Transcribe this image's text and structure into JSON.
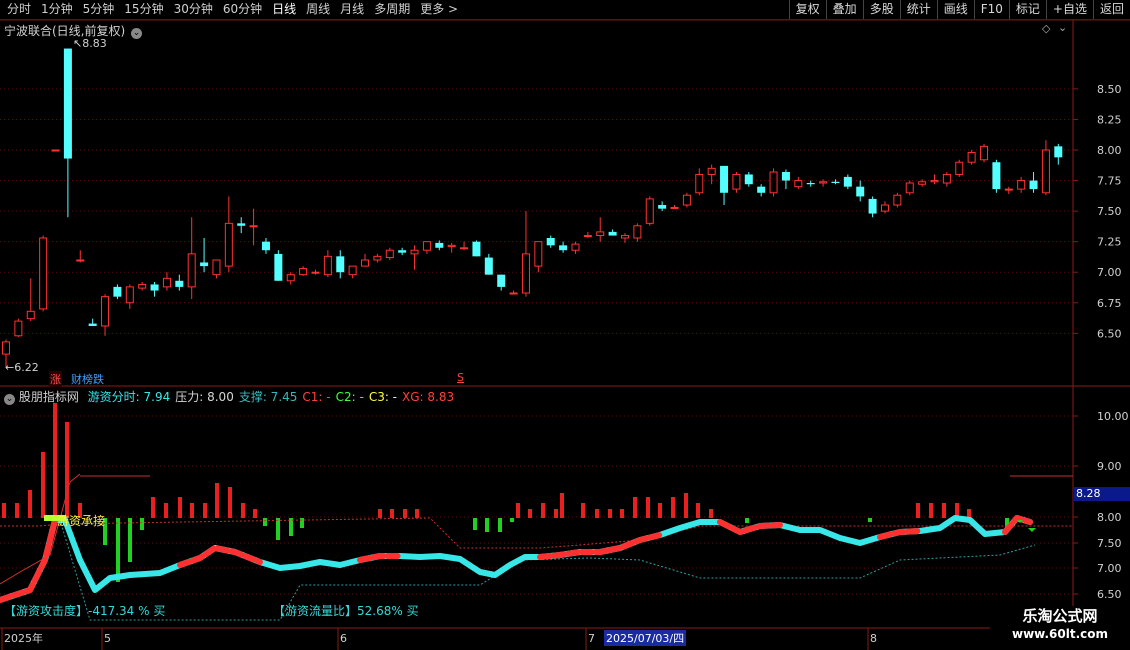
{
  "toolbar": {
    "periods": [
      "分时",
      "1分钟",
      "5分钟",
      "15分钟",
      "30分钟",
      "60分钟",
      "日线",
      "周线",
      "月线",
      "多周期",
      "更多 >"
    ],
    "active_period": "日线",
    "actions": [
      "复权",
      "叠加",
      "多股",
      "统计",
      "画线",
      "F10",
      "标记",
      "+自选",
      "返回"
    ]
  },
  "main_panel": {
    "title": "宁波联合(日线,前复权)",
    "high_marker": "8.83",
    "low_marker": "6.22",
    "y_ticks": [
      "8.50",
      "8.25",
      "8.00",
      "7.75",
      "7.50",
      "7.25",
      "7.00",
      "6.75",
      "6.50"
    ],
    "events": {
      "zhang": "涨",
      "caibang": "财榜跌",
      "s": "S"
    }
  },
  "indicator_panel": {
    "name": "股朋指标网",
    "values": [
      {
        "label": "游资分时: 7.94",
        "color": "#38e8e8"
      },
      {
        "label": "压力: 8.00",
        "color": "#d8d8d8"
      },
      {
        "label": "支撑: 7.45",
        "color": "#38b8b8"
      },
      {
        "label": "C1: -",
        "color": "#ff4040"
      },
      {
        "label": "C2: -",
        "color": "#40ff40"
      },
      {
        "label": "C3: -",
        "color": "#ffff40"
      },
      {
        "label": "XG: 8.83",
        "color": "#ff4040"
      }
    ],
    "y_ticks": [
      "10.00",
      "9.00",
      "8.00",
      "7.50",
      "7.00",
      "6.50"
    ],
    "current_value": "8.28",
    "annotation": "游资承接",
    "footer_left": "【游资攻击度】-417.34 % 买",
    "footer_right": "【游资流量比】52.68% 买"
  },
  "date_axis": {
    "labels": [
      "2025年",
      "5",
      "6",
      "7",
      "8"
    ],
    "cursor_date": "2025/07/03/四"
  },
  "watermark": {
    "line1": "乐淘公式网",
    "line2": "www.60lt.com"
  },
  "chart_data": {
    "type": "candlestick",
    "title": "宁波联合(日线,前复权)",
    "ylim": [
      6.2,
      8.9
    ],
    "candles": [
      {
        "o": 6.33,
        "h": 6.45,
        "l": 6.22,
        "c": 6.43
      },
      {
        "o": 6.48,
        "h": 6.62,
        "l": 6.47,
        "c": 6.6
      },
      {
        "o": 6.62,
        "h": 6.95,
        "l": 6.6,
        "c": 6.68
      },
      {
        "o": 6.7,
        "h": 7.3,
        "l": 6.68,
        "c": 7.28
      },
      {
        "o": 8.0,
        "h": 8.0,
        "l": 8.0,
        "c": 8.0
      },
      {
        "o": 8.83,
        "h": 8.83,
        "l": 7.45,
        "c": 7.93
      },
      {
        "o": 7.1,
        "h": 7.18,
        "l": 7.08,
        "c": 7.1
      },
      {
        "o": 6.58,
        "h": 6.62,
        "l": 6.56,
        "c": 6.56
      },
      {
        "o": 6.56,
        "h": 6.82,
        "l": 6.48,
        "c": 6.8
      },
      {
        "o": 6.88,
        "h": 6.9,
        "l": 6.78,
        "c": 6.8
      },
      {
        "o": 6.75,
        "h": 6.9,
        "l": 6.7,
        "c": 6.88
      },
      {
        "o": 6.87,
        "h": 6.92,
        "l": 6.85,
        "c": 6.9
      },
      {
        "o": 6.9,
        "h": 6.92,
        "l": 6.8,
        "c": 6.85
      },
      {
        "o": 6.88,
        "h": 7.0,
        "l": 6.85,
        "c": 6.95
      },
      {
        "o": 6.93,
        "h": 6.98,
        "l": 6.85,
        "c": 6.88
      },
      {
        "o": 6.88,
        "h": 7.45,
        "l": 6.78,
        "c": 7.15
      },
      {
        "o": 7.08,
        "h": 7.28,
        "l": 7.0,
        "c": 7.05
      },
      {
        "o": 6.98,
        "h": 7.1,
        "l": 6.95,
        "c": 7.1
      },
      {
        "o": 7.05,
        "h": 7.62,
        "l": 7.0,
        "c": 7.4
      },
      {
        "o": 7.4,
        "h": 7.45,
        "l": 7.32,
        "c": 7.38
      },
      {
        "o": 7.38,
        "h": 7.52,
        "l": 7.22,
        "c": 7.38
      },
      {
        "o": 7.25,
        "h": 7.28,
        "l": 7.15,
        "c": 7.18
      },
      {
        "o": 7.15,
        "h": 7.18,
        "l": 6.93,
        "c": 6.93
      },
      {
        "o": 6.93,
        "h": 7.0,
        "l": 6.9,
        "c": 6.98
      },
      {
        "o": 6.98,
        "h": 7.05,
        "l": 6.97,
        "c": 7.03
      },
      {
        "o": 7.0,
        "h": 7.02,
        "l": 6.98,
        "c": 7.0
      },
      {
        "o": 6.98,
        "h": 7.18,
        "l": 6.96,
        "c": 7.13
      },
      {
        "o": 7.13,
        "h": 7.18,
        "l": 6.95,
        "c": 7.0
      },
      {
        "o": 6.98,
        "h": 7.05,
        "l": 6.95,
        "c": 7.05
      },
      {
        "o": 7.05,
        "h": 7.15,
        "l": 7.05,
        "c": 7.1
      },
      {
        "o": 7.1,
        "h": 7.15,
        "l": 7.08,
        "c": 7.13
      },
      {
        "o": 7.12,
        "h": 7.2,
        "l": 7.1,
        "c": 7.18
      },
      {
        "o": 7.18,
        "h": 7.2,
        "l": 7.14,
        "c": 7.16
      },
      {
        "o": 7.15,
        "h": 7.22,
        "l": 7.02,
        "c": 7.18
      },
      {
        "o": 7.18,
        "h": 7.25,
        "l": 7.15,
        "c": 7.25
      },
      {
        "o": 7.24,
        "h": 7.26,
        "l": 7.18,
        "c": 7.2
      },
      {
        "o": 7.21,
        "h": 7.24,
        "l": 7.16,
        "c": 7.22
      },
      {
        "o": 7.2,
        "h": 7.25,
        "l": 7.18,
        "c": 7.2
      },
      {
        "o": 7.25,
        "h": 7.26,
        "l": 7.13,
        "c": 7.13
      },
      {
        "o": 7.12,
        "h": 7.15,
        "l": 6.98,
        "c": 6.98
      },
      {
        "o": 6.98,
        "h": 6.98,
        "l": 6.85,
        "c": 6.88
      },
      {
        "o": 6.83,
        "h": 6.85,
        "l": 6.82,
        "c": 6.83
      },
      {
        "o": 6.83,
        "h": 7.5,
        "l": 6.8,
        "c": 7.15
      },
      {
        "o": 7.05,
        "h": 7.25,
        "l": 7.0,
        "c": 7.25
      },
      {
        "o": 7.28,
        "h": 7.3,
        "l": 7.2,
        "c": 7.22
      },
      {
        "o": 7.22,
        "h": 7.25,
        "l": 7.16,
        "c": 7.18
      },
      {
        "o": 7.18,
        "h": 7.25,
        "l": 7.15,
        "c": 7.23
      },
      {
        "o": 7.3,
        "h": 7.33,
        "l": 7.28,
        "c": 7.3
      },
      {
        "o": 7.3,
        "h": 7.45,
        "l": 7.25,
        "c": 7.33
      },
      {
        "o": 7.33,
        "h": 7.35,
        "l": 7.3,
        "c": 7.3
      },
      {
        "o": 7.28,
        "h": 7.32,
        "l": 7.24,
        "c": 7.3
      },
      {
        "o": 7.28,
        "h": 7.4,
        "l": 7.25,
        "c": 7.38
      },
      {
        "o": 7.4,
        "h": 7.62,
        "l": 7.38,
        "c": 7.6
      },
      {
        "o": 7.55,
        "h": 7.58,
        "l": 7.5,
        "c": 7.52
      },
      {
        "o": 7.53,
        "h": 7.55,
        "l": 7.52,
        "c": 7.53
      },
      {
        "o": 7.55,
        "h": 7.65,
        "l": 7.53,
        "c": 7.63
      },
      {
        "o": 7.65,
        "h": 7.85,
        "l": 7.63,
        "c": 7.8
      },
      {
        "o": 7.8,
        "h": 7.88,
        "l": 7.72,
        "c": 7.85
      },
      {
        "o": 7.87,
        "h": 7.87,
        "l": 7.55,
        "c": 7.65
      },
      {
        "o": 7.68,
        "h": 7.82,
        "l": 7.65,
        "c": 7.8
      },
      {
        "o": 7.8,
        "h": 7.82,
        "l": 7.7,
        "c": 7.72
      },
      {
        "o": 7.7,
        "h": 7.72,
        "l": 7.62,
        "c": 7.65
      },
      {
        "o": 7.65,
        "h": 7.85,
        "l": 7.62,
        "c": 7.82
      },
      {
        "o": 7.82,
        "h": 7.84,
        "l": 7.68,
        "c": 7.75
      },
      {
        "o": 7.7,
        "h": 7.78,
        "l": 7.68,
        "c": 7.75
      },
      {
        "o": 7.73,
        "h": 7.75,
        "l": 7.7,
        "c": 7.72
      },
      {
        "o": 7.73,
        "h": 7.76,
        "l": 7.7,
        "c": 7.74
      },
      {
        "o": 7.74,
        "h": 7.76,
        "l": 7.72,
        "c": 7.73
      },
      {
        "o": 7.78,
        "h": 7.8,
        "l": 7.68,
        "c": 7.7
      },
      {
        "o": 7.7,
        "h": 7.75,
        "l": 7.58,
        "c": 7.62
      },
      {
        "o": 7.6,
        "h": 7.62,
        "l": 7.45,
        "c": 7.48
      },
      {
        "o": 7.5,
        "h": 7.58,
        "l": 7.48,
        "c": 7.55
      },
      {
        "o": 7.55,
        "h": 7.65,
        "l": 7.53,
        "c": 7.63
      },
      {
        "o": 7.65,
        "h": 7.75,
        "l": 7.63,
        "c": 7.73
      },
      {
        "o": 7.72,
        "h": 7.76,
        "l": 7.7,
        "c": 7.74
      },
      {
        "o": 7.74,
        "h": 7.8,
        "l": 7.72,
        "c": 7.75
      },
      {
        "o": 7.73,
        "h": 7.82,
        "l": 7.7,
        "c": 7.8
      },
      {
        "o": 7.8,
        "h": 7.92,
        "l": 7.78,
        "c": 7.9
      },
      {
        "o": 7.9,
        "h": 8.0,
        "l": 7.88,
        "c": 7.98
      },
      {
        "o": 7.92,
        "h": 8.05,
        "l": 7.9,
        "c": 8.03
      },
      {
        "o": 7.9,
        "h": 7.92,
        "l": 7.65,
        "c": 7.68
      },
      {
        "o": 7.68,
        "h": 7.7,
        "l": 7.64,
        "c": 7.68
      },
      {
        "o": 7.68,
        "h": 7.78,
        "l": 7.65,
        "c": 7.75
      },
      {
        "o": 7.75,
        "h": 7.82,
        "l": 7.65,
        "c": 7.68
      },
      {
        "o": 7.65,
        "h": 8.08,
        "l": 7.63,
        "c": 8.0
      },
      {
        "o": 8.03,
        "h": 8.05,
        "l": 7.88,
        "c": 7.94
      }
    ]
  }
}
